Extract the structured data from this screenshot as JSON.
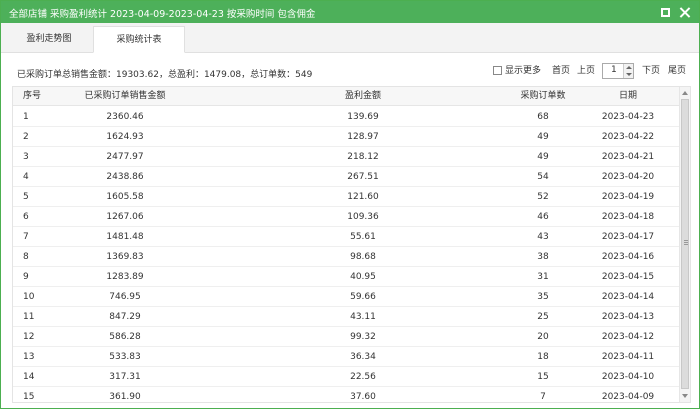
{
  "window": {
    "title": "全部店铺 采购盈利统计 2023-04-09-2023-04-23 按采购时间 包含佣金",
    "maximize_icon": "maximize-icon",
    "close_icon": "close-icon"
  },
  "tabs": [
    {
      "label": "盈利走势图",
      "active": false
    },
    {
      "label": "采购统计表",
      "active": true
    }
  ],
  "summary": "已采购订单总销售金额：19303.62，总盈利：1479.08，总订单数：549",
  "pager": {
    "show_more_label": "显示更多",
    "show_more_checked": false,
    "first_label": "首页",
    "prev_label": "上页",
    "page_value": "1",
    "next_label": "下页",
    "last_label": "尾页"
  },
  "table": {
    "headers": {
      "idx": "序号",
      "sale": "已采购订单销售金额",
      "profit": "盈利金额",
      "orders": "采购订单数",
      "date": "日期"
    },
    "rows": [
      {
        "idx": "1",
        "sale": "2360.46",
        "profit": "139.69",
        "orders": "68",
        "date": "2023-04-23"
      },
      {
        "idx": "2",
        "sale": "1624.93",
        "profit": "128.97",
        "orders": "49",
        "date": "2023-04-22"
      },
      {
        "idx": "3",
        "sale": "2477.97",
        "profit": "218.12",
        "orders": "49",
        "date": "2023-04-21"
      },
      {
        "idx": "4",
        "sale": "2438.86",
        "profit": "267.51",
        "orders": "54",
        "date": "2023-04-20"
      },
      {
        "idx": "5",
        "sale": "1605.58",
        "profit": "121.60",
        "orders": "52",
        "date": "2023-04-19"
      },
      {
        "idx": "6",
        "sale": "1267.06",
        "profit": "109.36",
        "orders": "46",
        "date": "2023-04-18"
      },
      {
        "idx": "7",
        "sale": "1481.48",
        "profit": "55.61",
        "orders": "43",
        "date": "2023-04-17"
      },
      {
        "idx": "8",
        "sale": "1369.83",
        "profit": "98.68",
        "orders": "38",
        "date": "2023-04-16"
      },
      {
        "idx": "9",
        "sale": "1283.89",
        "profit": "40.95",
        "orders": "31",
        "date": "2023-04-15"
      },
      {
        "idx": "10",
        "sale": "746.95",
        "profit": "59.66",
        "orders": "35",
        "date": "2023-04-14"
      },
      {
        "idx": "11",
        "sale": "847.29",
        "profit": "43.11",
        "orders": "25",
        "date": "2023-04-13"
      },
      {
        "idx": "12",
        "sale": "586.28",
        "profit": "99.32",
        "orders": "20",
        "date": "2023-04-12"
      },
      {
        "idx": "13",
        "sale": "533.83",
        "profit": "36.34",
        "orders": "18",
        "date": "2023-04-11"
      },
      {
        "idx": "14",
        "sale": "317.31",
        "profit": "22.56",
        "orders": "15",
        "date": "2023-04-10"
      },
      {
        "idx": "15",
        "sale": "361.90",
        "profit": "37.60",
        "orders": "7",
        "date": "2023-04-09"
      }
    ]
  },
  "colors": {
    "titlebar": "#4db05a",
    "border": "#4caf50"
  }
}
